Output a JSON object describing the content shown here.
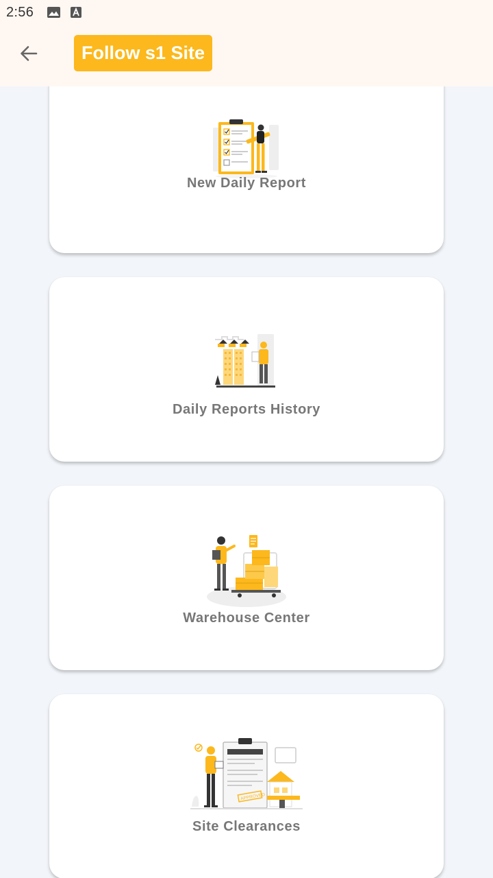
{
  "status_bar": {
    "time": "2:56",
    "icons": [
      "image-icon",
      "text-a-icon"
    ]
  },
  "app_bar": {
    "back_icon": "arrow-left-icon",
    "title": "Follow s1 Site"
  },
  "cards": [
    {
      "label": "New Daily Report",
      "illustration": "checklist-clipboard-illustration"
    },
    {
      "label": "Daily Reports History",
      "illustration": "construction-site-illustration"
    },
    {
      "label": "Warehouse Center",
      "illustration": "warehouse-boxes-illustration"
    },
    {
      "label": "Site Clearances",
      "illustration": "approved-document-illustration"
    }
  ],
  "colors": {
    "accent": "#fcb81c",
    "app_bar_bg": "#fff7f2",
    "page_bg": "#f2f5f9",
    "card_bg": "#ffffff",
    "label_text": "#777777"
  }
}
